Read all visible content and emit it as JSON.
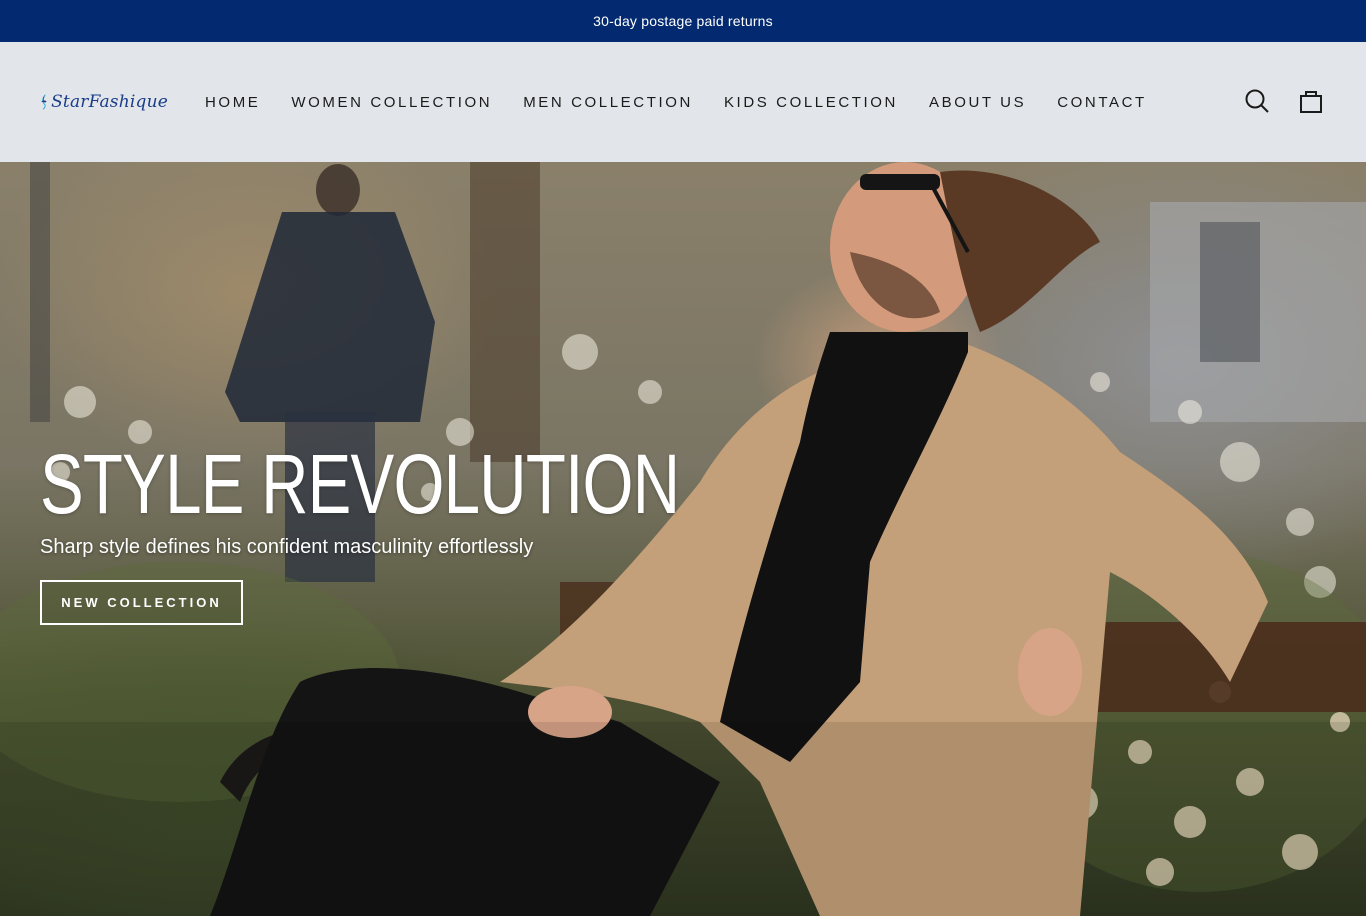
{
  "announcement": {
    "text": "30-day postage paid returns"
  },
  "logo": {
    "text": "StarFashique"
  },
  "nav": {
    "items": [
      {
        "label": "HOME"
      },
      {
        "label": "WOMEN COLLECTION"
      },
      {
        "label": "MEN COLLECTION"
      },
      {
        "label": "KIDS COLLECTION"
      },
      {
        "label": "ABOUT US"
      },
      {
        "label": "CONTACT"
      }
    ]
  },
  "header_icons": [
    "search-icon",
    "cart-icon"
  ],
  "hero": {
    "title": "STYLE REVOLUTION",
    "subtitle": "Sharp style defines his confident masculinity effortlessly",
    "button_label": "NEW COLLECTION"
  },
  "colors": {
    "announcement_bg": "#032a70",
    "header_bg": "#e2e5e9",
    "logo_blue": "#1a3d8a",
    "logo_cyan": "#1fa3d9"
  }
}
